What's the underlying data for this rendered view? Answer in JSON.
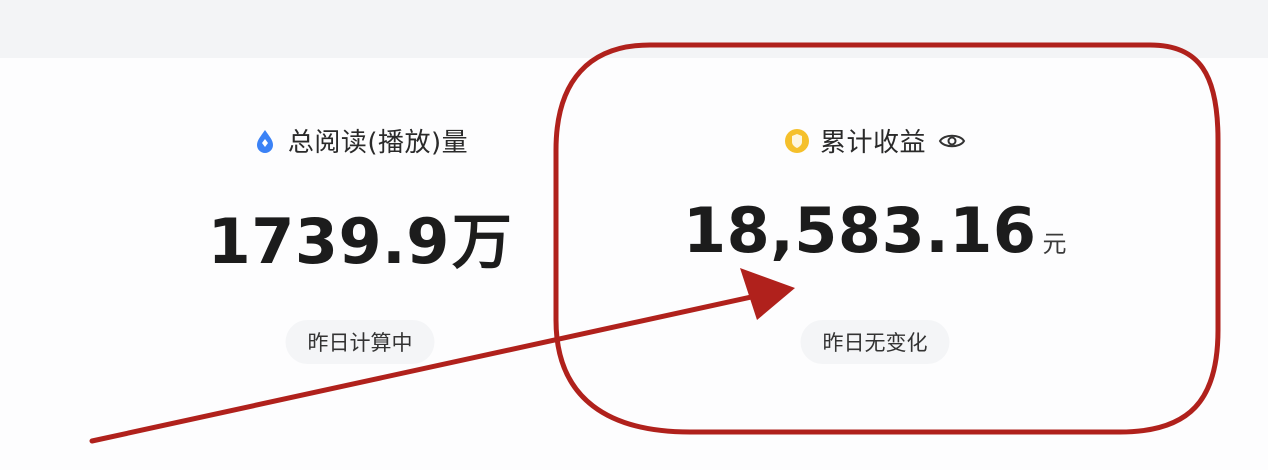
{
  "stats": {
    "reads": {
      "label": "总阅读(播放)量",
      "value": "1739.9",
      "unit": "万",
      "status": "昨日计算中",
      "icon": "droplet-icon",
      "icon_color": "#3b82f6"
    },
    "earnings": {
      "label": "累计收益",
      "value": "18,583.16",
      "unit": "元",
      "status": "昨日无变化",
      "icon": "coin-icon",
      "icon_color": "#f5c02b",
      "visibility_icon": "eye-icon"
    }
  },
  "annotation": {
    "color": "#b0211c",
    "shapes": [
      "red-rounded-rect-highlight",
      "red-arrow"
    ]
  }
}
